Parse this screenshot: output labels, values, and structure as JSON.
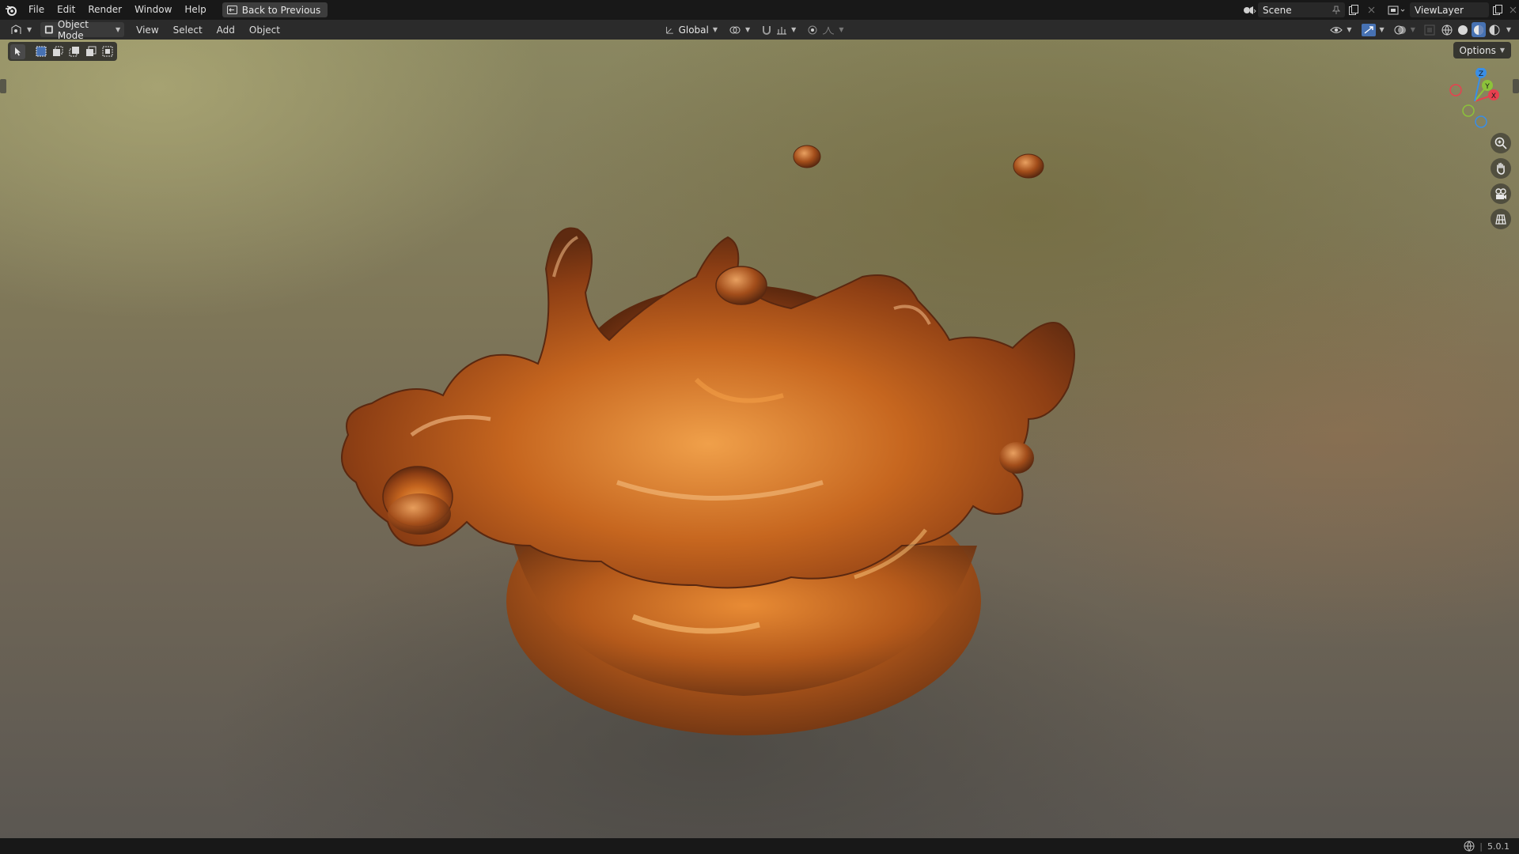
{
  "menubar": {
    "items": [
      "File",
      "Edit",
      "Render",
      "Window",
      "Help"
    ],
    "back_button": "Back to Previous"
  },
  "scene": {
    "label": "Scene"
  },
  "view_layer": {
    "label": "ViewLayer"
  },
  "viewport_header": {
    "mode": "Object Mode",
    "menus": [
      "View",
      "Select",
      "Add",
      "Object"
    ],
    "transform_orientation": "Global"
  },
  "viewport": {
    "options_label": "Options",
    "gizmo_axes": {
      "x": "X",
      "y": "Y",
      "z": "Z"
    }
  },
  "colors": {
    "axis_x": "#e8404f",
    "axis_y": "#8cc23a",
    "axis_z": "#3a8ee6",
    "liquid": "#b8561a",
    "liquid_highlight": "#f2a04a"
  },
  "statusbar": {
    "version": "5.0.1"
  }
}
